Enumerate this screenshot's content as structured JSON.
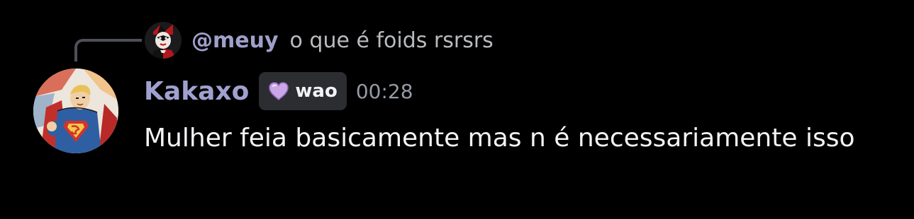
{
  "reply": {
    "username": "@meuy",
    "text": "o que é foids rsrsrs",
    "avatar_icon": "harley-quinn-avatar-icon"
  },
  "message": {
    "author": "Kakaxo",
    "avatar_icon": "superman-comic-avatar-icon",
    "tag": {
      "icon": "purple-heart-icon",
      "label": "wao"
    },
    "timestamp": "00:28",
    "content": "Mulher feia basicamente mas n é necessariamente isso"
  },
  "colors": {
    "background": "#000000",
    "author_name": "#a0a1d0",
    "reply_username": "#9fa0c9",
    "body_text": "#f2f3f5",
    "muted_text": "#949ba4",
    "tag_background": "#2b2d31",
    "heart": "#c9a6e6"
  }
}
